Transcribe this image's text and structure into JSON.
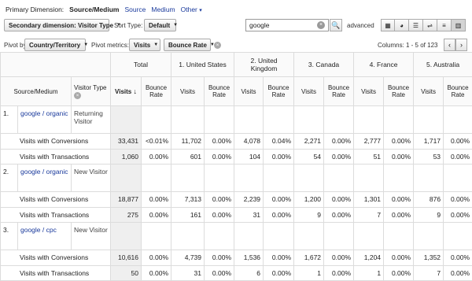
{
  "primary": {
    "label": "Primary Dimension:",
    "current": "Source/Medium",
    "links": [
      "Source",
      "Medium",
      "Other"
    ]
  },
  "controls": {
    "secondary_dim": "Secondary dimension: Visitor Type",
    "sort_type_label": "Sort Type:",
    "sort_type_value": "Default",
    "search_value": "google",
    "advanced": "advanced",
    "pivot_by_label": "Pivot by:",
    "pivot_by_value": "Country/Territory",
    "pivot_metrics_label": "Pivot metrics:",
    "metric1": "Visits",
    "metric2": "Bounce Rate",
    "columns_label": "Columns:",
    "columns_range": "1 - 5 of 123"
  },
  "table": {
    "total_label": "Total",
    "countries": [
      "1. United States",
      "2. United Kingdom",
      "3. Canada",
      "4. France",
      "5. Australia"
    ],
    "col_source": "Source/Medium",
    "col_visitor": "Visitor Type",
    "visits_sorted": "Visits",
    "visits": "Visits",
    "bounce": "Bounce Rate",
    "groups": [
      {
        "index": "1.",
        "source": "google / organic",
        "visitor": "Returning Visitor",
        "rows": [
          {
            "label": "Visits with Conversions",
            "total": "33,431",
            "total_br": "<0.01%",
            "cells": [
              "11,702",
              "0.00%",
              "4,078",
              "0.04%",
              "2,271",
              "0.00%",
              "2,777",
              "0.00%",
              "1,717",
              "0.00%"
            ]
          },
          {
            "label": "Visits with Transactions",
            "total": "1,060",
            "total_br": "0.00%",
            "cells": [
              "601",
              "0.00%",
              "104",
              "0.00%",
              "54",
              "0.00%",
              "51",
              "0.00%",
              "53",
              "0.00%"
            ]
          }
        ]
      },
      {
        "index": "2.",
        "source": "google / organic",
        "visitor": "New Visitor",
        "rows": [
          {
            "label": "Visits with Conversions",
            "total": "18,877",
            "total_br": "0.00%",
            "cells": [
              "7,313",
              "0.00%",
              "2,239",
              "0.00%",
              "1,200",
              "0.00%",
              "1,301",
              "0.00%",
              "876",
              "0.00%"
            ]
          },
          {
            "label": "Visits with Transactions",
            "total": "275",
            "total_br": "0.00%",
            "cells": [
              "161",
              "0.00%",
              "31",
              "0.00%",
              "9",
              "0.00%",
              "7",
              "0.00%",
              "9",
              "0.00%"
            ]
          }
        ]
      },
      {
        "index": "3.",
        "source": "google / cpc",
        "visitor": "New Visitor",
        "rows": [
          {
            "label": "Visits with Conversions",
            "total": "10,616",
            "total_br": "0.00%",
            "cells": [
              "4,739",
              "0.00%",
              "1,536",
              "0.00%",
              "1,672",
              "0.00%",
              "1,204",
              "0.00%",
              "1,352",
              "0.00%"
            ]
          },
          {
            "label": "Visits with Transactions",
            "total": "50",
            "total_br": "0.00%",
            "cells": [
              "31",
              "0.00%",
              "6",
              "0.00%",
              "1",
              "0.00%",
              "1",
              "0.00%",
              "7",
              "0.00%"
            ]
          }
        ]
      }
    ]
  }
}
